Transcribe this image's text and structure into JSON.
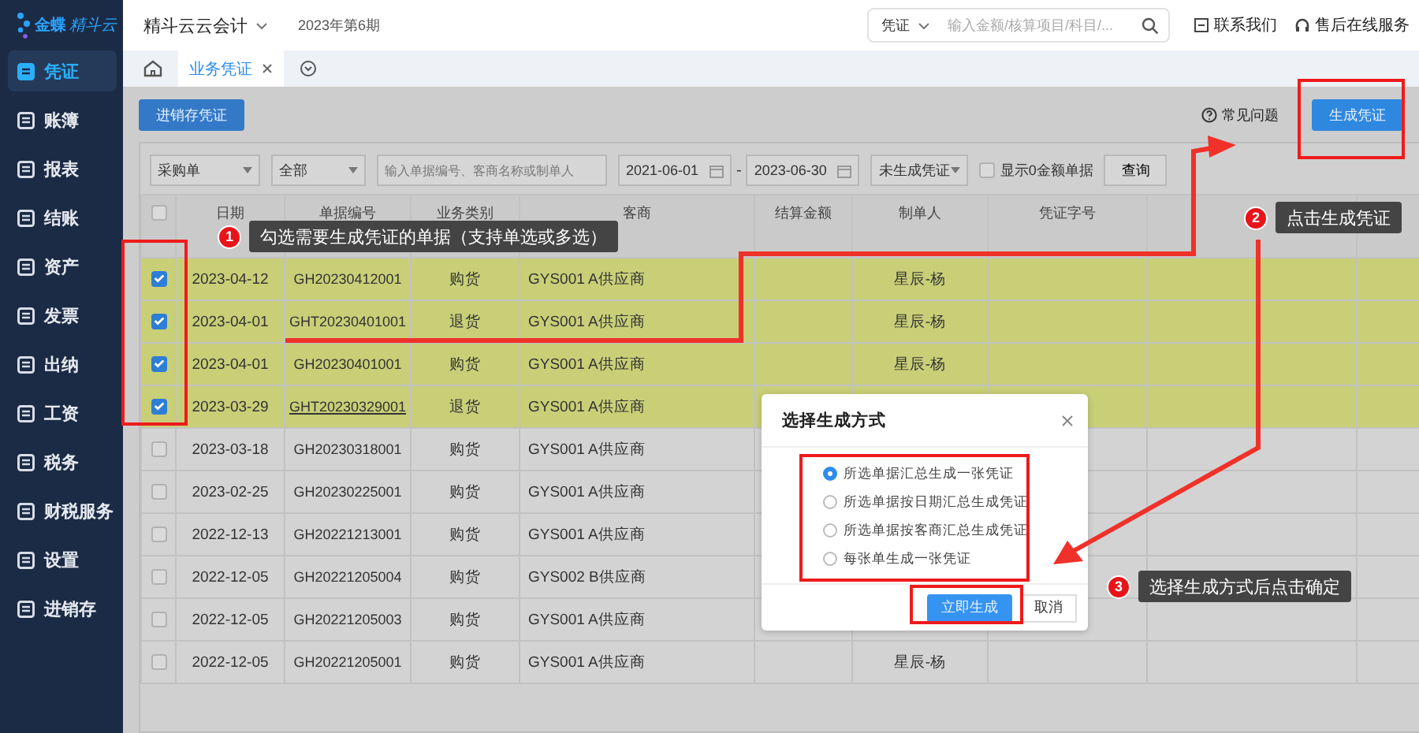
{
  "logo": {
    "brand": "金蝶",
    "product": "精斗云"
  },
  "sidebar": {
    "items": [
      {
        "label": "凭证",
        "selected": true
      },
      {
        "label": "账簿",
        "selected": false
      },
      {
        "label": "报表",
        "selected": false
      },
      {
        "label": "结账",
        "selected": false
      },
      {
        "label": "资产",
        "selected": false
      },
      {
        "label": "发票",
        "selected": false
      },
      {
        "label": "出纳",
        "selected": false
      },
      {
        "label": "工资",
        "selected": false
      },
      {
        "label": "税务",
        "selected": false
      },
      {
        "label": "财税服务",
        "selected": false
      },
      {
        "label": "设置",
        "selected": false
      },
      {
        "label": "进销存",
        "selected": false
      }
    ]
  },
  "top_bar": {
    "app_name": "精斗云云会计",
    "period": "2023年第6期",
    "search": {
      "scope": "凭证",
      "placeholder": "输入金额/核算项目/科目/..."
    },
    "links": [
      {
        "label": "联系我们",
        "kind": "contact"
      },
      {
        "label": "售后在线服务",
        "kind": "support"
      }
    ]
  },
  "tabs": [
    {
      "label": "业务凭证",
      "selected": true
    }
  ],
  "toolbar": {
    "primary_button": "进销存凭证",
    "help_link": "常见问题",
    "generate_button": "生成凭证"
  },
  "filters": {
    "doc_type": "采购单",
    "category": "全部",
    "search_placeholder": "输入单据编号、客商名称或制单人",
    "date_from": "2021-06-01",
    "date_separator": "-",
    "date_to": "2023-06-30",
    "status": "未生成凭证",
    "show_zero": {
      "label": "显示0金额单据",
      "checked": false
    },
    "query_button": "查询"
  },
  "table": {
    "header_checked": false,
    "columns": [
      "日期",
      "单据编号",
      "业务类别",
      "客商",
      "结算金额",
      "制单人",
      "凭证字号"
    ],
    "rows": [
      {
        "checked": true,
        "hovered": false,
        "date": "2023-04-12",
        "number": "GH20230412001",
        "type": "购货",
        "partner": "GYS001 A供应商",
        "maker": "星辰-杨"
      },
      {
        "checked": true,
        "hovered": false,
        "date": "2023-04-01",
        "number": "GHT20230401001",
        "type": "退货",
        "partner": "GYS001 A供应商",
        "maker": "星辰-杨"
      },
      {
        "checked": true,
        "hovered": false,
        "date": "2023-04-01",
        "number": "GH20230401001",
        "type": "购货",
        "partner": "GYS001 A供应商",
        "maker": "星辰-杨"
      },
      {
        "checked": true,
        "hovered": true,
        "date": "2023-03-29",
        "number": "GHT20230329001",
        "type": "退货",
        "partner": "GYS001 A供应商"
      },
      {
        "checked": false,
        "hovered": false,
        "date": "2023-03-18",
        "number": "GH20230318001",
        "type": "购货",
        "partner": "GYS001 A供应商"
      },
      {
        "checked": false,
        "hovered": false,
        "date": "2023-02-25",
        "number": "GH20230225001",
        "type": "购货",
        "partner": "GYS001 A供应商"
      },
      {
        "checked": false,
        "hovered": false,
        "date": "2022-12-13",
        "number": "GH20221213001",
        "type": "购货",
        "partner": "GYS001 A供应商"
      },
      {
        "checked": false,
        "hovered": false,
        "date": "2022-12-05",
        "number": "GH20221205004",
        "type": "购货",
        "partner": "GYS002 B供应商"
      },
      {
        "checked": false,
        "hovered": false,
        "date": "2022-12-05",
        "number": "GH20221205003",
        "type": "购货",
        "partner": "GYS001 A供应商"
      },
      {
        "checked": false,
        "hovered": false,
        "date": "2022-12-05",
        "number": "GH20221205001",
        "type": "购货",
        "partner": "GYS001 A供应商",
        "maker": "星辰-杨"
      }
    ]
  },
  "dialog": {
    "title": "选择生成方式",
    "options": [
      {
        "label": "所选单据汇总生成一张凭证",
        "selected": true
      },
      {
        "label": "所选单据按日期汇总生成凭证",
        "selected": false
      },
      {
        "label": "所选单据按客商汇总生成凭证",
        "selected": false
      },
      {
        "label": "每张单生成一张凭证",
        "selected": false
      }
    ],
    "confirm_button": "立即生成",
    "cancel_button": "取消"
  },
  "callouts": [
    {
      "number": "1",
      "text": "勾选需要生成凭证的单据（支持单选或多选）"
    },
    {
      "number": "2",
      "text": "点击生成凭证"
    },
    {
      "number": "3",
      "text": "选择生成方式后点击确定"
    }
  ]
}
